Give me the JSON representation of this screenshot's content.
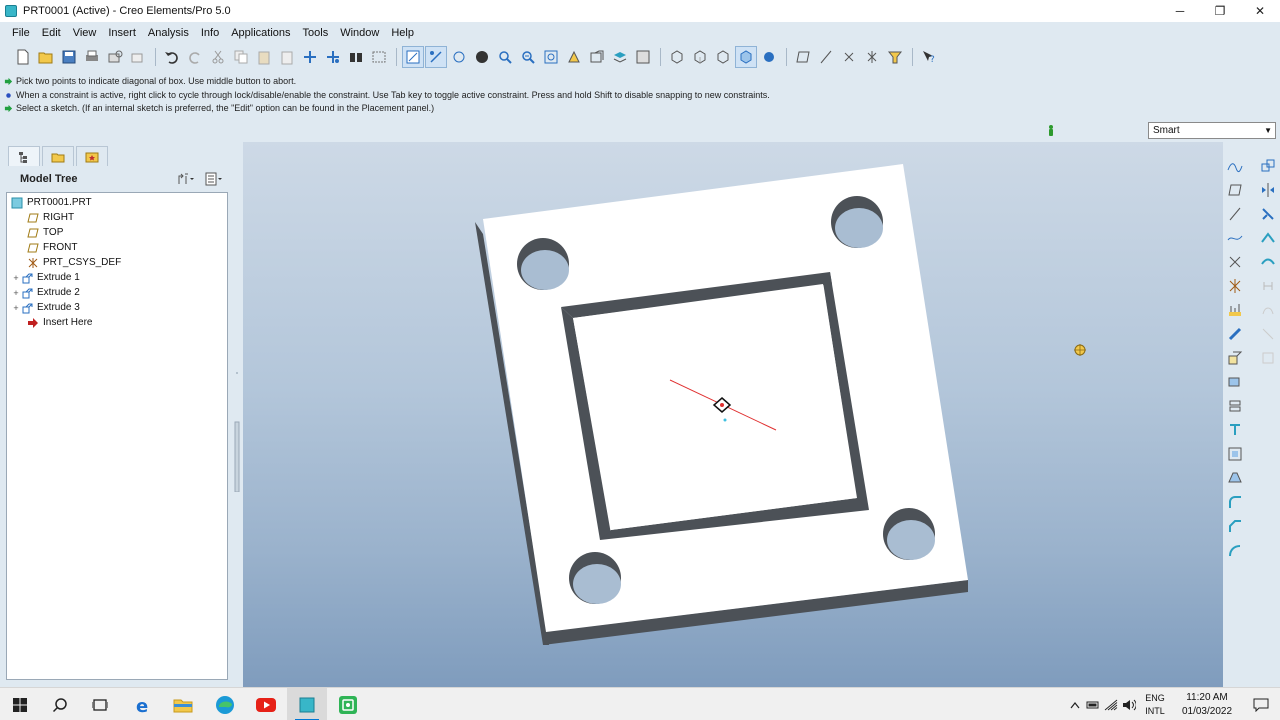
{
  "window": {
    "title": "PRT0001 (Active) - Creo Elements/Pro 5.0",
    "minimize": "─",
    "maximize": "❐",
    "close": "✕"
  },
  "menu": [
    "File",
    "Edit",
    "View",
    "Insert",
    "Analysis",
    "Info",
    "Applications",
    "Tools",
    "Window",
    "Help"
  ],
  "messages": [
    {
      "icon": "arrow-prompt-icon",
      "text": "Pick two points to indicate diagonal of box. Use middle button to abort."
    },
    {
      "icon": "info-bullet-icon",
      "text": "When a constraint is active, right click to cycle through lock/disable/enable the constraint. Use Tab key to toggle active constraint. Press and hold Shift to disable snapping to new constraints."
    },
    {
      "icon": "arrow-prompt-icon",
      "text": "Select a sketch. (If an internal sketch is preferred, the \"Edit\" option can be found in the Placement panel.)"
    }
  ],
  "filter": {
    "selected": "Smart"
  },
  "model_tree": {
    "title": "Model Tree",
    "items": [
      {
        "label": "PRT0001.PRT",
        "icon": "part-icon",
        "indent": 0,
        "expander": ""
      },
      {
        "label": "RIGHT",
        "icon": "datum-plane-icon",
        "indent": 1,
        "expander": ""
      },
      {
        "label": "TOP",
        "icon": "datum-plane-icon",
        "indent": 1,
        "expander": ""
      },
      {
        "label": "FRONT",
        "icon": "datum-plane-icon",
        "indent": 1,
        "expander": ""
      },
      {
        "label": "PRT_CSYS_DEF",
        "icon": "csys-icon",
        "indent": 1,
        "expander": ""
      },
      {
        "label": "Extrude 1",
        "icon": "extrude-icon",
        "indent": 1,
        "expander": "+"
      },
      {
        "label": "Extrude 2",
        "icon": "extrude-icon",
        "indent": 1,
        "expander": "+"
      },
      {
        "label": "Extrude 3",
        "icon": "extrude-icon",
        "indent": 1,
        "expander": "+"
      },
      {
        "label": "Insert Here",
        "icon": "insert-here-icon",
        "indent": 1,
        "expander": ""
      }
    ]
  },
  "taskbar": {
    "apps": [
      "windows-start-icon",
      "search-icon",
      "task-view-icon",
      "edge-legacy-icon",
      "file-explorer-icon",
      "edge-icon",
      "youtube-icon",
      "creo-app-icon",
      "screen-recorder-icon"
    ],
    "lang_top": "ENG",
    "lang_bottom": "INTL",
    "time": "11:20 AM",
    "date": "01/03/2022"
  },
  "colors": {
    "accent": "#0078d4",
    "sketch_line": "#e03030",
    "part_face": "#ffffff",
    "part_edge": "#4a4f55"
  }
}
